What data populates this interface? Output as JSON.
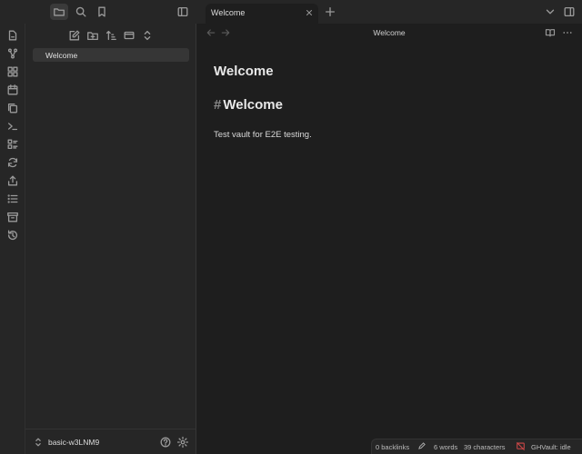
{
  "titlebar": {
    "tab_title": "Welcome"
  },
  "icons": {
    "files": "folder-icon",
    "search": "search-icon",
    "bookmarks": "bookmark-icon",
    "sidebar_toggle": "sidebar-toggle-icon",
    "new_tab": "plus-icon",
    "tab_list": "chevron-down-icon",
    "right_sidebar": "right-sidebar-icon"
  },
  "sidebar": {
    "file_items": [
      "Welcome"
    ],
    "vault_name": "basic-w3LNM9"
  },
  "editor": {
    "view_title": "Welcome",
    "inline_title": "Welcome",
    "heading_hash": "#",
    "heading_text": "Welcome",
    "body_text": "Test vault for E2E testing."
  },
  "statusbar": {
    "backlinks": "0 backlinks",
    "words": "6 words",
    "characters": "39 characters",
    "plugin_status": "GHVault: idle"
  },
  "colors": {
    "background": "#1e1e1e",
    "panel": "#262626",
    "selected_item": "#363636",
    "status_icon_red": "#d04848"
  }
}
